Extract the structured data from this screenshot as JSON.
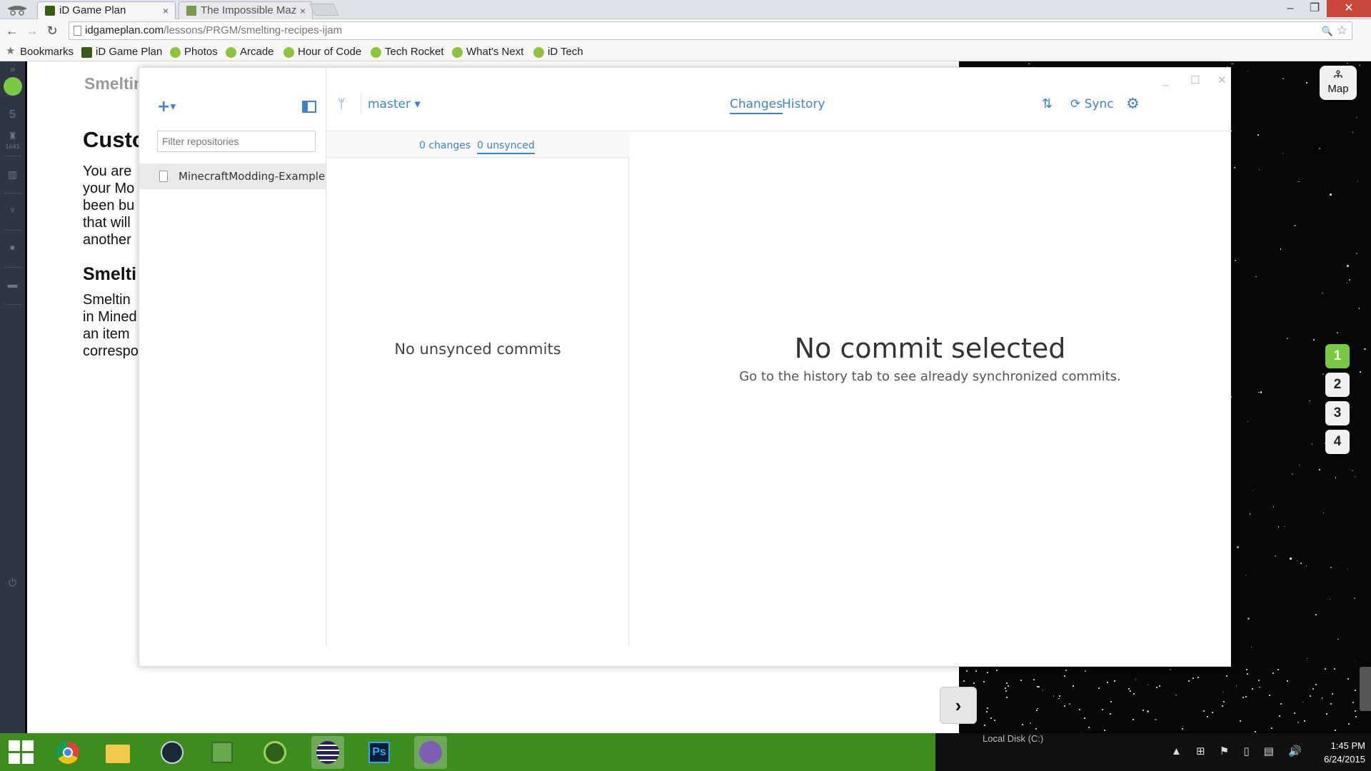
{
  "browser": {
    "tabs": [
      {
        "title": "iD Game Plan",
        "close": "×",
        "active": true
      },
      {
        "title": "The Impossible Maze",
        "close": "×",
        "active": false
      }
    ],
    "window_controls": {
      "minimize": "–",
      "maximize": "❐",
      "close": "✕"
    },
    "url": {
      "host": "idgameplan.com",
      "path": "/lessons/PRGM/smelting-recipes-ijam"
    },
    "nav": {
      "back": "←",
      "forward": "→",
      "reload": "↻",
      "menu": "≡",
      "zoom": "🔍",
      "star": "☆"
    },
    "bookmarks": [
      {
        "label": "Bookmarks",
        "icon": "star-icon"
      },
      {
        "label": "iD Game Plan",
        "icon": "gameplan-icon"
      },
      {
        "label": "Photos",
        "icon": "idtech-icon"
      },
      {
        "label": "Arcade",
        "icon": "check-icon"
      },
      {
        "label": "Hour of Code",
        "icon": "check-icon"
      },
      {
        "label": "Tech Rocket",
        "icon": "check-icon"
      },
      {
        "label": "What's Next",
        "icon": "idtech-icon"
      },
      {
        "label": "iD Tech",
        "icon": "idtech-icon"
      }
    ]
  },
  "page": {
    "rail": {
      "level": "5",
      "xp": "1641"
    },
    "lesson_title": "Smelting I",
    "heading": "Custo",
    "intro_lines": [
      "You are",
      "your Mo",
      "been bu",
      "that will",
      "another"
    ],
    "subheading": "Smelti",
    "smelt_lines": [
      "Smeltin",
      "in Mined",
      "an item",
      "correspo"
    ],
    "next_button": "›",
    "map_label": "Map",
    "steps": [
      "1",
      "2",
      "3",
      "4"
    ],
    "active_step": "1"
  },
  "github": {
    "window_controls": {
      "minimize": "_",
      "maximize": "☐",
      "close": "✕"
    },
    "add": "+",
    "filter_placeholder": "Filter repositories",
    "repo": "MinecraftModding-Example",
    "branch": "master ▾",
    "tabs": {
      "changes": "Changes",
      "history": "History"
    },
    "sync": "Sync",
    "subtabs": {
      "changes": "0 changes",
      "unsynced": "0 unsynced"
    },
    "empty_commits": "No unsynced commits",
    "detail_title": "No commit selected",
    "detail_sub": "Go to the history tab to see already synchronized commits."
  },
  "taskbar": {
    "local_disk": "Local Disk (C:)",
    "time": "1:45 PM",
    "date": "6/24/2015",
    "tray": "▲ ⊞ ⚑ ▯ ▤ 🔊",
    "colors": {
      "taskbar": "#3c8c1e",
      "accent": "#4183c4",
      "step_active": "#7ac943"
    }
  }
}
